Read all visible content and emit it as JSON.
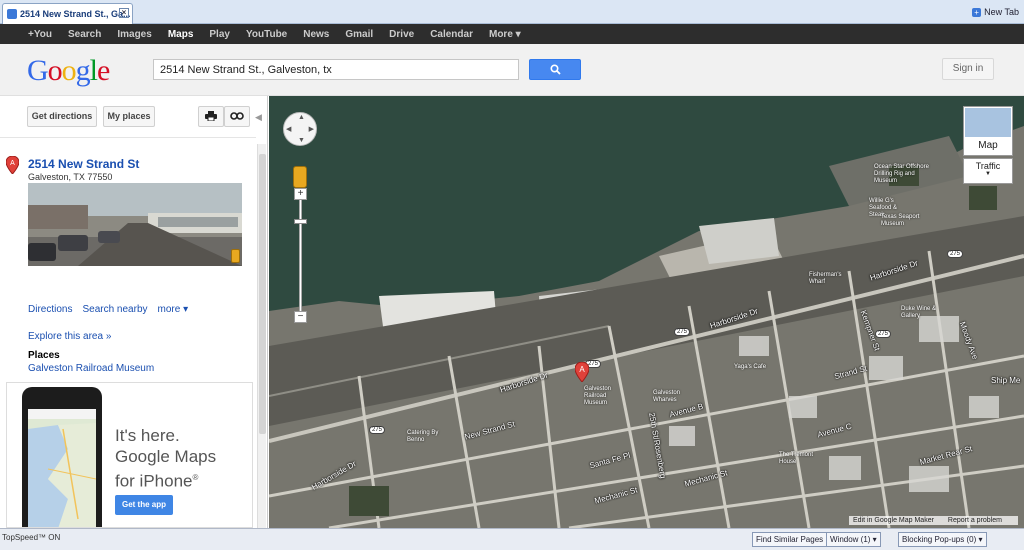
{
  "browser": {
    "tab_title": "2514 New Strand St., Ga...",
    "new_tab": "New Tab"
  },
  "gbar": {
    "items": [
      "+You",
      "Search",
      "Images",
      "Maps",
      "Play",
      "YouTube",
      "News",
      "Gmail",
      "Drive",
      "Calendar",
      "More ▾"
    ],
    "active": "Maps"
  },
  "header": {
    "logo": [
      "G",
      "o",
      "o",
      "g",
      "l",
      "e"
    ],
    "search_value": "2514 New Strand St., Galveston, tx",
    "sign_in": "Sign in"
  },
  "sidebar": {
    "get_directions": "Get directions",
    "my_places": "My places",
    "pin_letter": "A",
    "place_title": "2514 New Strand St",
    "place_address": "Galveston, TX 77550",
    "links": [
      "Directions",
      "Search nearby",
      "more ▾"
    ],
    "explore": "Explore this area »",
    "places_heading": "Places",
    "places_link": "Galveston Railroad Museum",
    "ad": {
      "line1": "It's here.",
      "line2": "Google Maps",
      "line3": "for iPhone",
      "reg": "®",
      "button": "Get the app"
    }
  },
  "map": {
    "type_label": "Map",
    "traffic_label": "Traffic",
    "pin_letter": "A",
    "footer": [
      "Edit in Google Map Maker",
      "Report a problem"
    ],
    "road_labels": {
      "harborside_1": "Harborside Dr",
      "harborside_2": "Harborside Dr",
      "harborside_3": "Harborside Dr",
      "harborside_4": "Harborside Dr",
      "new_strand": "New Strand St",
      "strand_st": "Strand St",
      "avenue_b": "Avenue B",
      "avenue_c": "Avenue C",
      "mechanic_1": "Mechanic St",
      "mechanic_2": "Mechanic St",
      "market": "Market Rear St",
      "santa_fe": "Santa Fe Pl",
      "ship_me": "Ship Me",
      "moody": "Moody Ave",
      "kempner": "Kempner St",
      "rosenberg": "25th St/Rosenberg"
    },
    "pois": {
      "ocean_star": "Ocean Star Offshore Drilling Rig and Museum",
      "willie_gs": "Willie G's Seafood & Steak",
      "texas_seaport": "Texas Seaport Museum",
      "fishermans": "Fisherman's Wharf",
      "duke": "Duke Wine & Gallery",
      "yaga": "Yaga's Cafe",
      "railroad_museum": "Galveston Railroad Museum",
      "wharves": "Galveston Wharves",
      "catering": "Catering By Benno",
      "tremont": "The Tremont House"
    },
    "shields": [
      "275",
      "275",
      "275",
      "275",
      "275"
    ]
  },
  "statusbar": {
    "left": "TopSpeed™ ON",
    "find_similar": "Find Similar Pages",
    "window": "Window (1)",
    "popups": "Blocking Pop-ups (0)"
  },
  "colors": {
    "logo": [
      "#3369e8",
      "#d50f25",
      "#eeb211",
      "#3369e8",
      "#009925",
      "#d50f25"
    ],
    "water": "#2f4a40",
    "link": "#1a4fb0"
  }
}
